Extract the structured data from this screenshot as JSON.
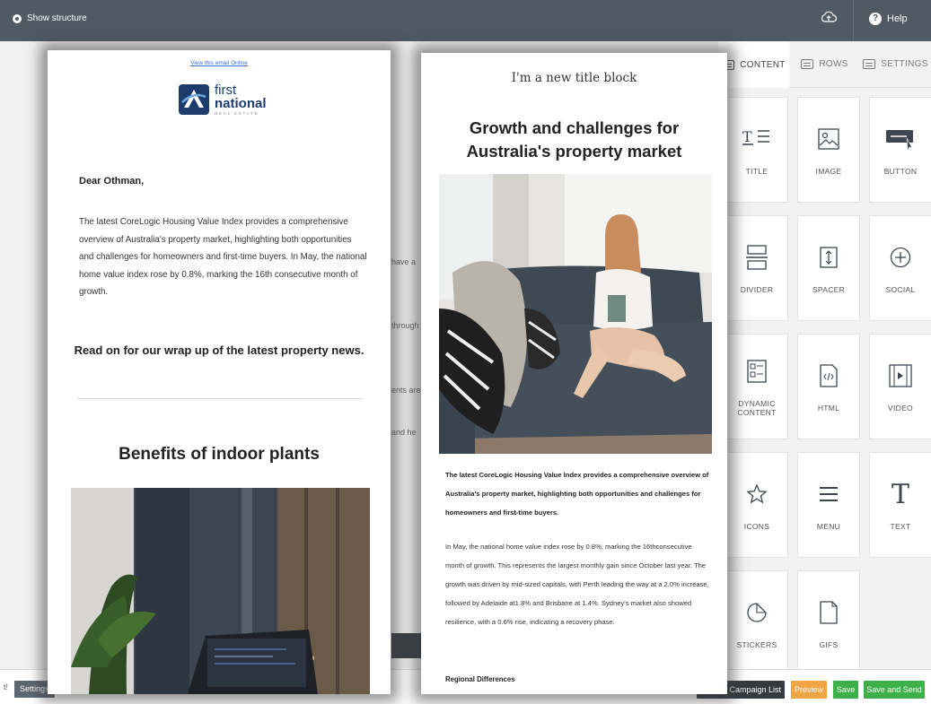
{
  "topbar": {
    "show_structure": "Show structure",
    "help": "Help"
  },
  "background": {
    "snippets": [
      "have a",
      "through",
      "ents are",
      "and he"
    ]
  },
  "sidebar": {
    "tabs": [
      {
        "label": "CONTENT",
        "active": true
      },
      {
        "label": "ROWS",
        "active": false
      },
      {
        "label": "SETTINGS",
        "active": false
      }
    ],
    "tiles": [
      {
        "label": "TITLE",
        "icon": "title-icon"
      },
      {
        "label": "IMAGE",
        "icon": "image-icon"
      },
      {
        "label": "BUTTON",
        "icon": "button-icon"
      },
      {
        "label": "DIVIDER",
        "icon": "divider-icon"
      },
      {
        "label": "SPACER",
        "icon": "spacer-icon"
      },
      {
        "label": "SOCIAL",
        "icon": "social-icon"
      },
      {
        "label": "DYNAMIC CONTENT",
        "icon": "dynamic-content-icon"
      },
      {
        "label": "HTML",
        "icon": "html-icon"
      },
      {
        "label": "VIDEO",
        "icon": "video-icon"
      },
      {
        "label": "ICONS",
        "icon": "star-icon"
      },
      {
        "label": "MENU",
        "icon": "menu-icon"
      },
      {
        "label": "TEXT",
        "icon": "text-icon"
      },
      {
        "label": "STICKERS",
        "icon": "sticker-icon"
      },
      {
        "label": "GIFS",
        "icon": "gif-icon"
      }
    ]
  },
  "bottombar": {
    "settings": "Settings",
    "cut_text": "t!",
    "back_to_list": "Back to Campaign List",
    "preview": "Preview",
    "save": "Save",
    "save_and_send": "Save and Send"
  },
  "left_email": {
    "view_online": "View this email Online",
    "logo": {
      "line1": "first",
      "line2": "national",
      "line3": "REAL ESTATE"
    },
    "greeting": "Dear Othman,",
    "intro": "The latest CoreLogic Housing Value Index provides a comprehensive overview of Australia's property market, highlighting both opportunities and challenges for homeowners and first-time buyers. In May, the national home value index rose by 0.8%, marking the 16th consecutive month of growth.",
    "read_on": "Read on for our wrap up of the latest property news.",
    "section_title": "Benefits of indoor plants"
  },
  "right_email": {
    "title_block": "I'm a new title block",
    "headline": "Growth and challenges for Australia's property market",
    "bold_intro": "The latest CoreLogic Housing Value Index provides a comprehensive overview of Australia's property market, highlighting both opportunities and challenges for homeowners and first-time buyers.",
    "body": "In May, the national home value index rose by 0.8%, marking the 16thconsecutive month of growth. This represents the largest monthly gain since October last year. The growth was driven by mid-sized capitals, with Perth leading the way at a 2.0% increase, followed by Adelaide at1.8% and Brisbane at 1.4%. Sydney's market also showed resilience, with a 0.6% rise, indicating a recovery phase.",
    "subheading": "Regional Differences"
  },
  "colors": {
    "topbar": "#505a63",
    "brand_navy": "#1d3c6e",
    "save_green": "#3eb04a",
    "preview_orange": "#f0a443"
  }
}
